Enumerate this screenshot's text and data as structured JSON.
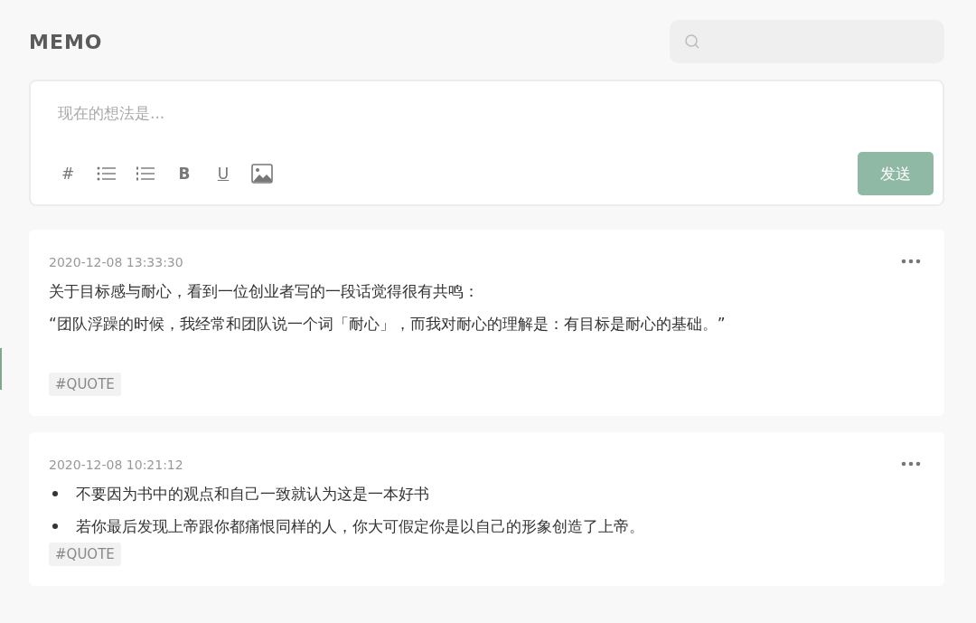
{
  "header": {
    "title": "MEMO",
    "search_field": true
  },
  "editor": {
    "placeholder": "现在的想法是...",
    "tools": [
      {
        "kind": "text",
        "label": "#"
      },
      {
        "kind": "bullet-list"
      },
      {
        "kind": "number-list"
      },
      {
        "kind": "bold",
        "label": "B"
      },
      {
        "kind": "underline",
        "label": "U"
      },
      {
        "kind": "image"
      }
    ],
    "send_button": {
      "label": "发送",
      "disabled": true
    }
  },
  "memos": [
    {
      "time": "2020-12-08 13:33:30",
      "kind": "paragraphs",
      "lines": [
        "关于目标感与耐心，看到一位创业者写的一段话觉得很有共鸣：",
        "“团队浮躁的时候，我经常和团队说一个词「耐心」，而我对耐心的理解是：有目标是耐心的基础。”"
      ],
      "tags": [
        "#QUOTE"
      ]
    },
    {
      "time": "2020-12-08 10:21:12",
      "kind": "bullets",
      "lines": [
        "不要因为书中的观点和自己一致就认为这是一本好书",
        "若你最后发现上帝跟你都痛恨同样的人，你大可假定你是以自己的形象创造了上帝。"
      ],
      "tags": [
        "#QUOTE"
      ]
    }
  ]
}
